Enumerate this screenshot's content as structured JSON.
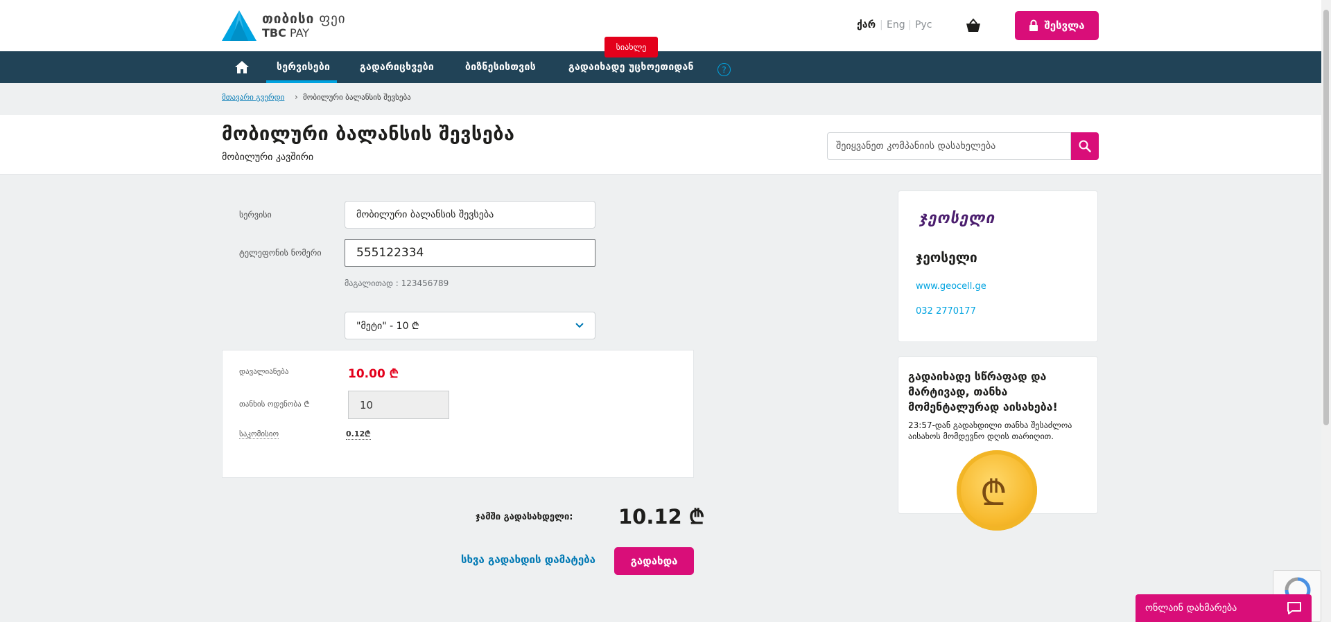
{
  "header": {
    "logo_line1_bold": "თიბისი",
    "logo_line1_light": "ფეი",
    "logo_line2_bold": "TBC",
    "logo_line2_light": "PAY",
    "languages": [
      "ქარ",
      "Eng",
      "Рус"
    ],
    "login_label": "შესვლა"
  },
  "nav": {
    "items": [
      "სერვისები",
      "გადარიცხვები",
      "ბიზნესისთვის",
      "გადაიხადე უცხოეთიდან"
    ],
    "new_badge": "სიახლე",
    "help": "?"
  },
  "breadcrumb": {
    "home": "მთავარი გვერდი",
    "current": "მობილური ბალანსის შევსება"
  },
  "page": {
    "title": "მობილური ბალანსის შევსება",
    "subtitle": "მობილური კავშირი",
    "search_placeholder": "შეიყვანეთ კომპანიის დასახელება"
  },
  "form": {
    "service_label": "სერვისი",
    "service_value": "მობილური ბალანსის შევსება",
    "phone_label": "ტელეფონის ნომერი",
    "phone_value": "555122334",
    "phone_hint": "მაგალითად : 123456789",
    "package_value": "\"მეტი\" - 10 ₾"
  },
  "summary": {
    "debt_label": "დავალიანება",
    "debt_value": "10.00 ₾",
    "amount_label": "თანხის ოდენობა ₾",
    "amount_value": "10",
    "commission_label": "საკომისიო",
    "commission_value": "0.12₾"
  },
  "total": {
    "label": "ჯამში გადასახდელი:",
    "value": "10.12 ₾"
  },
  "actions": {
    "add_payment": "სხვა გადახდის დამატება",
    "pay": "გადახდა"
  },
  "provider": {
    "logo_text": "ჯეოსელი",
    "name": "ჯეოსელი",
    "website": "www.geocell.ge",
    "phone": "032 2770177"
  },
  "promo": {
    "title": "გადაიხადე სწრაფად და მარტივად, თანხა მომენტალურად აისახება!",
    "text": "23:57-დან გადახდილი თანხა შესაძლოა აისახოს მომდევნო დღის თარიღით."
  },
  "chat": {
    "label": "ონლაინ დახმარება"
  },
  "colors": {
    "brand_pink": "#d90e79",
    "nav_bg": "#214357",
    "accent_blue": "#00a3e0",
    "debt_red": "#e3001b"
  }
}
